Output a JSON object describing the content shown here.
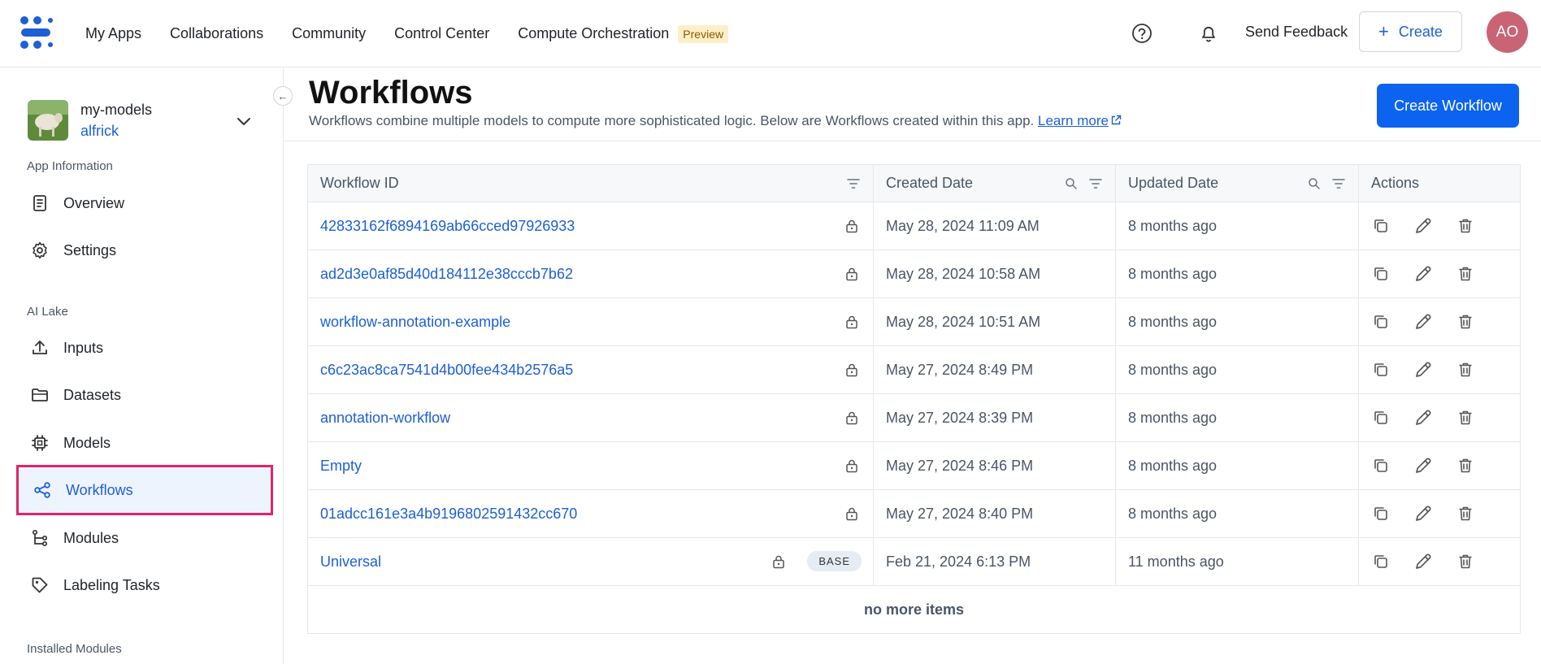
{
  "nav": {
    "links": [
      "My Apps",
      "Collaborations",
      "Community",
      "Control Center",
      "Compute Orchestration"
    ],
    "preview_badge": "Preview",
    "feedback": "Send Feedback",
    "create_label": "Create",
    "avatar_initials": "AO"
  },
  "sidebar": {
    "app_name": "my-models",
    "app_owner": "alfrick",
    "sections": {
      "app_info": "App Information",
      "ai_lake": "AI Lake",
      "installed": "Installed Modules"
    },
    "items": [
      {
        "label": "Overview",
        "icon": "document-icon"
      },
      {
        "label": "Settings",
        "icon": "gear-icon"
      },
      {
        "label": "Inputs",
        "icon": "upload-icon"
      },
      {
        "label": "Datasets",
        "icon": "folder-icon"
      },
      {
        "label": "Models",
        "icon": "chip-icon"
      },
      {
        "label": "Workflows",
        "icon": "share-icon",
        "active": true
      },
      {
        "label": "Modules",
        "icon": "tree-icon"
      },
      {
        "label": "Labeling Tasks",
        "icon": "tag-icon"
      }
    ]
  },
  "main": {
    "title": "Workflows",
    "description": "Workflows combine multiple models to compute more sophisticated logic. Below are Workflows created within this app.",
    "learn_more": "Learn more",
    "create_button": "Create Workflow"
  },
  "table": {
    "columns": [
      "Workflow ID",
      "Created Date",
      "Updated Date",
      "Actions"
    ],
    "rows": [
      {
        "id": "42833162f6894169ab66cced97926933",
        "created": "May 28, 2024 11:09 AM",
        "updated": "8 months ago"
      },
      {
        "id": "ad2d3e0af85d40d184112e38cccb7b62",
        "created": "May 28, 2024 10:58 AM",
        "updated": "8 months ago"
      },
      {
        "id": "workflow-annotation-example",
        "created": "May 28, 2024 10:51 AM",
        "updated": "8 months ago"
      },
      {
        "id": "c6c23ac8ca7541d4b00fee434b2576a5",
        "created": "May 27, 2024 8:49 PM",
        "updated": "8 months ago"
      },
      {
        "id": "annotation-workflow",
        "created": "May 27, 2024 8:39 PM",
        "updated": "8 months ago"
      },
      {
        "id": "Empty",
        "created": "May 27, 2024 8:46 PM",
        "updated": "8 months ago"
      },
      {
        "id": "01adcc161e3a4b9196802591432cc670",
        "created": "May 27, 2024 8:40 PM",
        "updated": "8 months ago"
      },
      {
        "id": "Universal",
        "created": "Feb 21, 2024 6:13 PM",
        "updated": "11 months ago",
        "badge": "BASE"
      }
    ],
    "footer": "no more items"
  },
  "colors": {
    "accent": "#0b63f0",
    "link": "#1d5fd6",
    "active_border": "#e2246a",
    "avatar": "#c86473"
  }
}
